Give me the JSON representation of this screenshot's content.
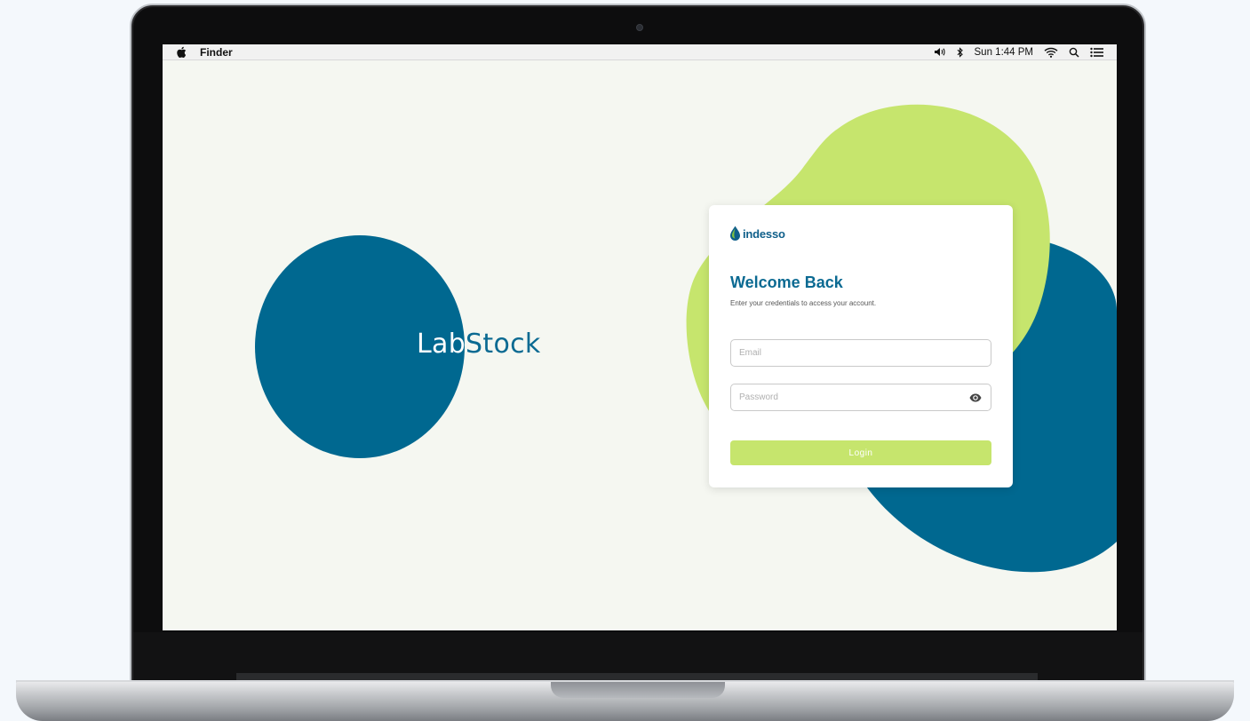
{
  "menubar": {
    "app_name": "Finder",
    "clock": "Sun 1:44 PM",
    "icons": [
      "apple-icon",
      "volume-icon",
      "bluetooth-icon",
      "wifi-icon",
      "search-icon",
      "menu-list-icon"
    ]
  },
  "brand": {
    "app_title_part1": "Lab",
    "app_title_part2": "Stock",
    "logo_text": "indesso"
  },
  "login": {
    "title": "Welcome Back",
    "subtitle": "Enter your credentials to access your account.",
    "email_placeholder": "Email",
    "email_value": "",
    "password_placeholder": "Password",
    "password_value": "",
    "button_label": "Login"
  },
  "colors": {
    "primary_blue": "#006890",
    "accent_green": "#c6e56d",
    "screen_background": "#f5f7f1"
  }
}
